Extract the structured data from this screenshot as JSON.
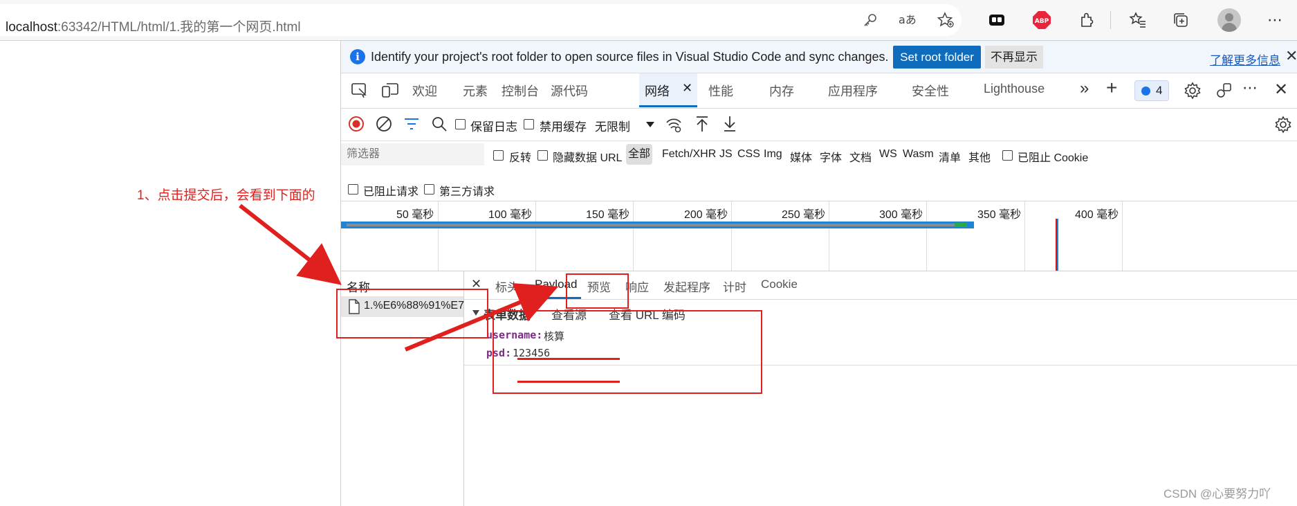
{
  "browser": {
    "url_host": "localhost",
    "url_rest": ":63342/HTML/html/1.我的第一个网页.html"
  },
  "infobar": {
    "message": "Identify your project's root folder to open source files in Visual Studio Code and sync changes.",
    "set_root_label": "Set root folder",
    "dont_show_label": "不再显示",
    "learn_more_label": "了解更多信息",
    "close_glyph": "✕"
  },
  "tabs": {
    "welcome": "欢迎",
    "elements": "元素",
    "console": "控制台",
    "sources": "源代码",
    "network": "网络",
    "network_close": "✕",
    "performance": "性能",
    "memory": "内存",
    "application": "应用程序",
    "security": "安全性",
    "lighthouse": "Lighthouse",
    "more_glyph": "»",
    "add_glyph": "+",
    "issues_count": "4",
    "more_menu_glyph": "⋯",
    "close_glyph": "✕"
  },
  "network_toolbar": {
    "preserve_log": "保留日志",
    "disable_cache": "禁用缓存",
    "throttling": "无限制"
  },
  "filter_row": {
    "placeholder": "筛选器",
    "invert": "反转",
    "hide_data_urls": "隐藏数据 URL",
    "all": "全部",
    "types": [
      "Fetch/XHR",
      "JS",
      "CSS",
      "Img",
      "媒体",
      "字体",
      "文档",
      "WS",
      "Wasm",
      "清单",
      "其他"
    ],
    "blocked_cookies": "已阻止 Cookie",
    "blocked_requests": "已阻止请求",
    "third_party": "第三方请求"
  },
  "timeline": {
    "ticks": [
      "50  毫秒",
      "100  毫秒",
      "150  毫秒",
      "200  毫秒",
      "250  毫秒",
      "300  毫秒",
      "350  毫秒",
      "400  毫秒"
    ]
  },
  "request_list": {
    "column_name": "名称",
    "request": "1.%E6%88%91%E7..."
  },
  "detail_tabs": {
    "close_glyph": "✕",
    "headers": "标头",
    "payload": "Payload",
    "preview": "预览",
    "response": "响应",
    "initiator": "发起程序",
    "timing": "计时",
    "cookie": "Cookie"
  },
  "form_data": {
    "section_title": "表单数据",
    "view_source": "查看源",
    "view_url_encoded": "查看 URL 编码",
    "fields": [
      {
        "key": "username:",
        "value": "核算"
      },
      {
        "key": "psd:",
        "value": "123456"
      }
    ]
  },
  "annotation": {
    "text": "1、点击提交后，会看到下面的"
  },
  "watermark": "CSDN @心要努力吖",
  "colors": {
    "accent": "#0f6cbd",
    "annotation_red": "#e0201e",
    "record_red": "#d93025"
  }
}
